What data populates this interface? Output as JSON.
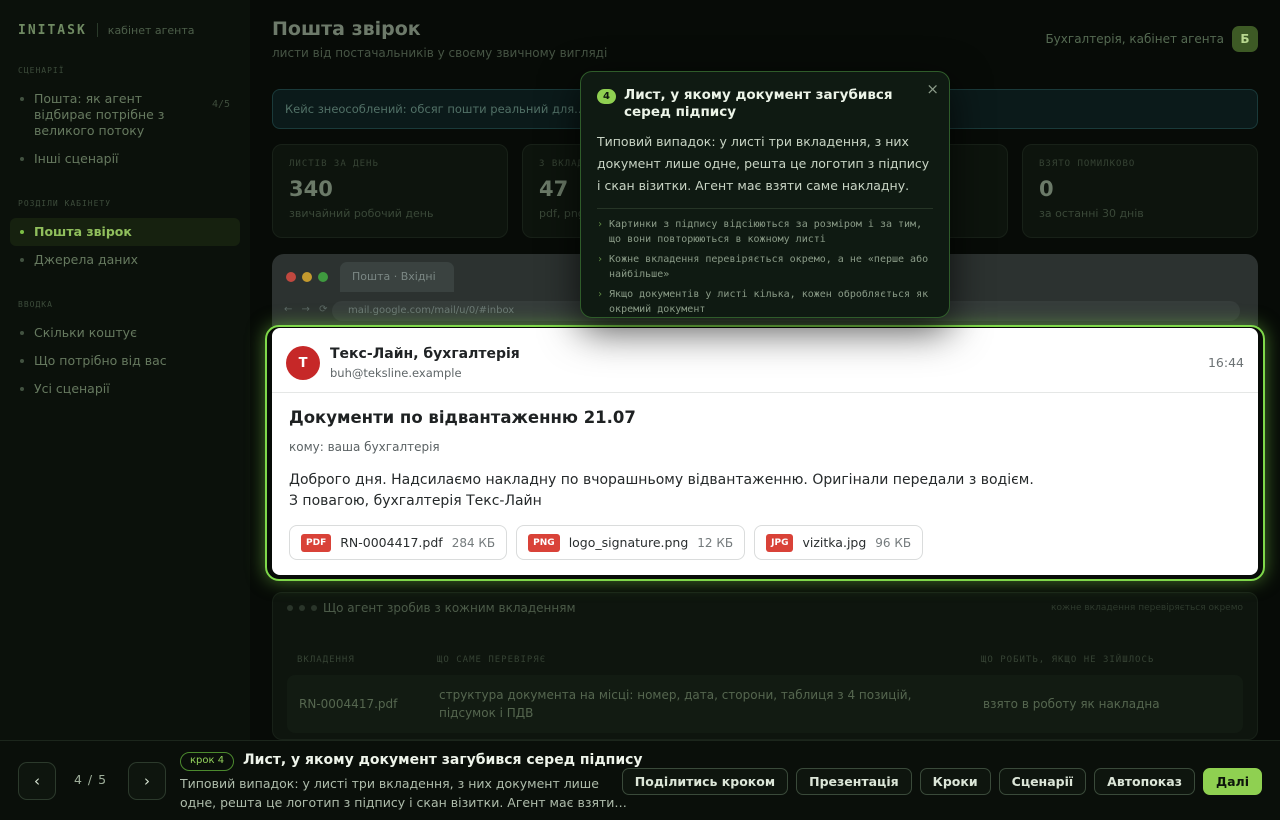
{
  "sidebar": {
    "logo": "INITASK",
    "logo_sub": "кабінет агента",
    "section_scenarios": "СЦЕНАРІЇ",
    "scenarios": [
      {
        "label": "Пошта: як агент відбирає потрібне з великого потоку",
        "count": "4/5"
      },
      {
        "label": "Інші сценарії"
      }
    ],
    "section_view": "РОЗДІЛИ КАБІНЕТУ",
    "view_items": [
      {
        "label": "Пошта звірок",
        "active": true
      },
      {
        "label": "Джерела даних"
      }
    ],
    "section_intro": "ВВОДКА",
    "intro_items": [
      {
        "label": "Скільки коштує"
      },
      {
        "label": "Що потрібно від вас"
      },
      {
        "label": "Усі сценарії"
      }
    ]
  },
  "header": {
    "title": "Пошта звірок",
    "subtitle": "листи від постачальників у своєму звичному вигляді",
    "user": "Бухгалтерія, кабінет агента",
    "user_initial": "Б"
  },
  "case_bar": "Кейс знеособлений: обсяг пошти реальний для...",
  "stats": [
    {
      "label": "ЛИСТІВ ЗА ДЕНЬ",
      "value": "340",
      "caption": "звичайний робочий день"
    },
    {
      "label": "З ВКЛАДЕННЯМИ",
      "value": "47",
      "caption": "pdf, png, jpg"
    },
    {
      "label": "",
      "value": "",
      "caption": ""
    },
    {
      "label": "ВЗЯТО ПОМИЛКОВО",
      "value": "0",
      "caption": "за останні 30 днів"
    }
  ],
  "browser": {
    "tab": "Пошта · Вхідні",
    "url": "mail.google.com/mail/u/0/#inbox",
    "traffic_colors": [
      "#c0483f",
      "#c49a2e",
      "#3f9a3f"
    ]
  },
  "email": {
    "avatar": "Т",
    "sender": "Текс-Лайн, бухгалтерія",
    "sender_email": "buh@teksline.example",
    "time": "16:44",
    "subject": "Документи по відвантаженню 21.07",
    "to": "кому: ваша бухгалтерія",
    "body_line1": "Доброго дня. Надсилаємо накладну по вчорашньому відвантаженню. Оригінали передали з водієм.",
    "body_line2": "З повагою, бухгалтерія Текс-Лайн",
    "attachments": [
      {
        "ext": "PDF",
        "name": "RN-0004417.pdf",
        "size": "284 КБ"
      },
      {
        "ext": "PNG",
        "name": "logo_signature.png",
        "size": "12 КБ"
      },
      {
        "ext": "JPG",
        "name": "vizitka.jpg",
        "size": "96 КБ"
      }
    ]
  },
  "agent_panel": {
    "title": "Що агент зробив з кожним вкладенням",
    "right": "кожне вкладення перевіряється окремо",
    "col1": "ВКЛАДЕННЯ",
    "col2": "ЩО САМЕ ПЕРЕВІРЯЄ",
    "col3": "ЩО РОБИТЬ, ЯКЩО НЕ ЗІЙШЛОСЬ",
    "row_file": "RN-0004417.pdf",
    "row_check": "структура документа на місці: номер, дата, сторони, таблиця з 4 позицій, підсумок і ПДВ",
    "row_action": "взято в роботу як накладна"
  },
  "tooltip": {
    "num": "4",
    "title": "Лист, у якому документ загубився серед підпису",
    "close": "×",
    "desc": "Типовий випадок: у листі три вкладення, з них документ лише одне, решта це логотип з підпису і скан візитки. Агент має взяти саме накладну.",
    "bullets": [
      "Картинки з підпису відсіюються за розміром і за тим, що вони повторюються в кожному листі",
      "Кожне вкладення перевіряється окремо, а не «перше або найбільше»",
      "Якщо документів у листі кілька, кожен обробляється як окремий документ"
    ]
  },
  "stepbar": {
    "prev": "‹",
    "next": "›",
    "counter": "4 / 5",
    "badge": "крок 4",
    "title": "Лист, у якому документ загубився серед підпису",
    "desc": "Типовий випадок: у листі три вкладення, з них документ лише одне, решта це логотип з підпису і скан візитки. Агент має взяти саме накладну.",
    "actions": [
      "Поділитись кроком",
      "Презентація",
      "Кроки",
      "Сценарії",
      "Автопоказ"
    ],
    "primary": "Далі"
  },
  "colors": {
    "accent": "#8fd051",
    "avatar_red": "#c62828",
    "ext_red": "#d94238"
  }
}
